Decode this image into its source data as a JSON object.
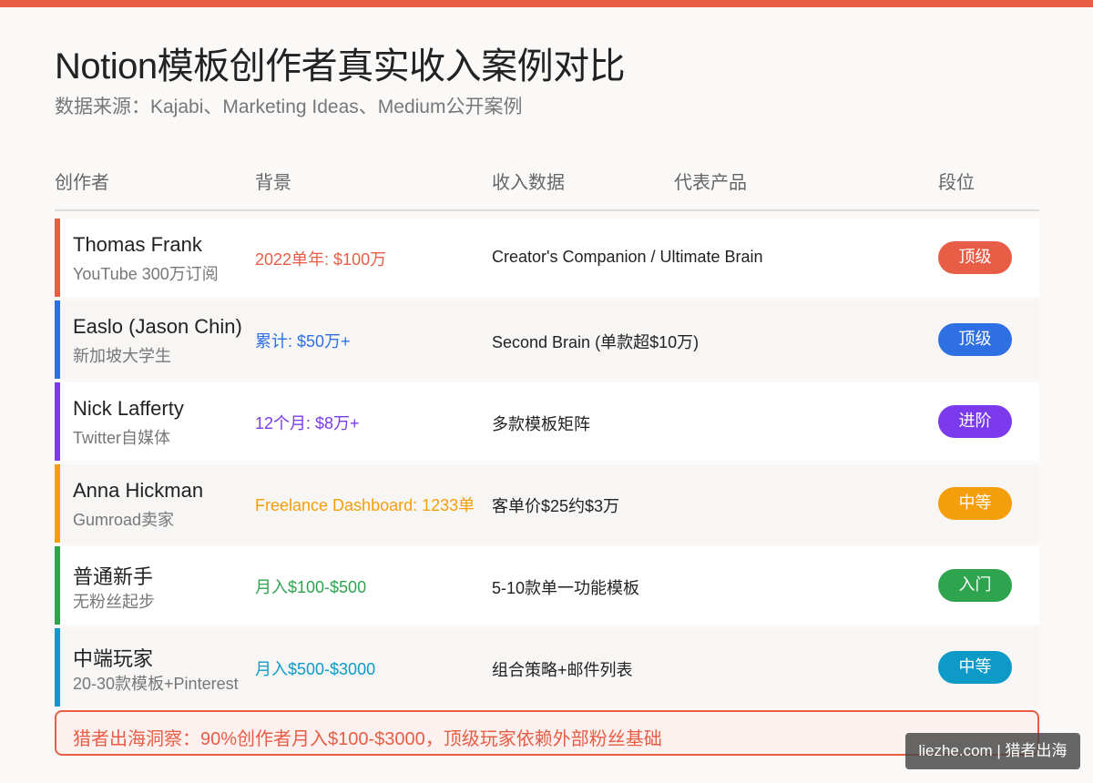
{
  "title": "Notion模板创作者真实收入案例对比",
  "subtitle": "数据来源：Kajabi、Marketing Ideas、Medium公开案例",
  "columns": {
    "creator": "创作者",
    "background": "背景",
    "income": "收入数据",
    "product": "代表产品",
    "tier": "段位"
  },
  "rows": [
    {
      "name": "Thomas Frank",
      "bg": "YouTube 300万订阅",
      "income": "2022单年: $100万",
      "product": "Creator's Companion / Ultimate Brain",
      "tier": "顶级",
      "color": "#e85d45"
    },
    {
      "name": "Easlo (Jason Chin)",
      "bg": "新加坡大学生",
      "income": "累计: $50万+",
      "product": "Second Brain (单款超$10万)",
      "tier": "顶级",
      "color": "#2f6fe4"
    },
    {
      "name": "Nick Lafferty",
      "bg": "Twitter自媒体",
      "income": "12个月: $8万+",
      "product": "多款模板矩阵",
      "tier": "进阶",
      "color": "#7c3aed"
    },
    {
      "name": "Anna Hickman",
      "bg": "Gumroad卖家",
      "income": "Freelance Dashboard: 1233单",
      "product": "客单价$25约$3万",
      "tier": "中等",
      "color": "#f59e0b"
    },
    {
      "name": "普通新手",
      "bg": "无粉丝起步",
      "income": "月入$100-$500",
      "product": "5-10款单一功能模板",
      "tier": "入门",
      "color": "#2ea44f"
    },
    {
      "name": "中端玩家",
      "bg": "20-30款模板+Pinterest",
      "income": "月入$500-$3000",
      "product": "组合策略+邮件列表",
      "tier": "中等",
      "color": "#0e9ac7"
    }
  ],
  "insight": "猎者出海洞察：90%创作者月入$100-$3000，顶级玩家依赖外部粉丝基础",
  "watermark": "liezhe.com | 猎者出海"
}
